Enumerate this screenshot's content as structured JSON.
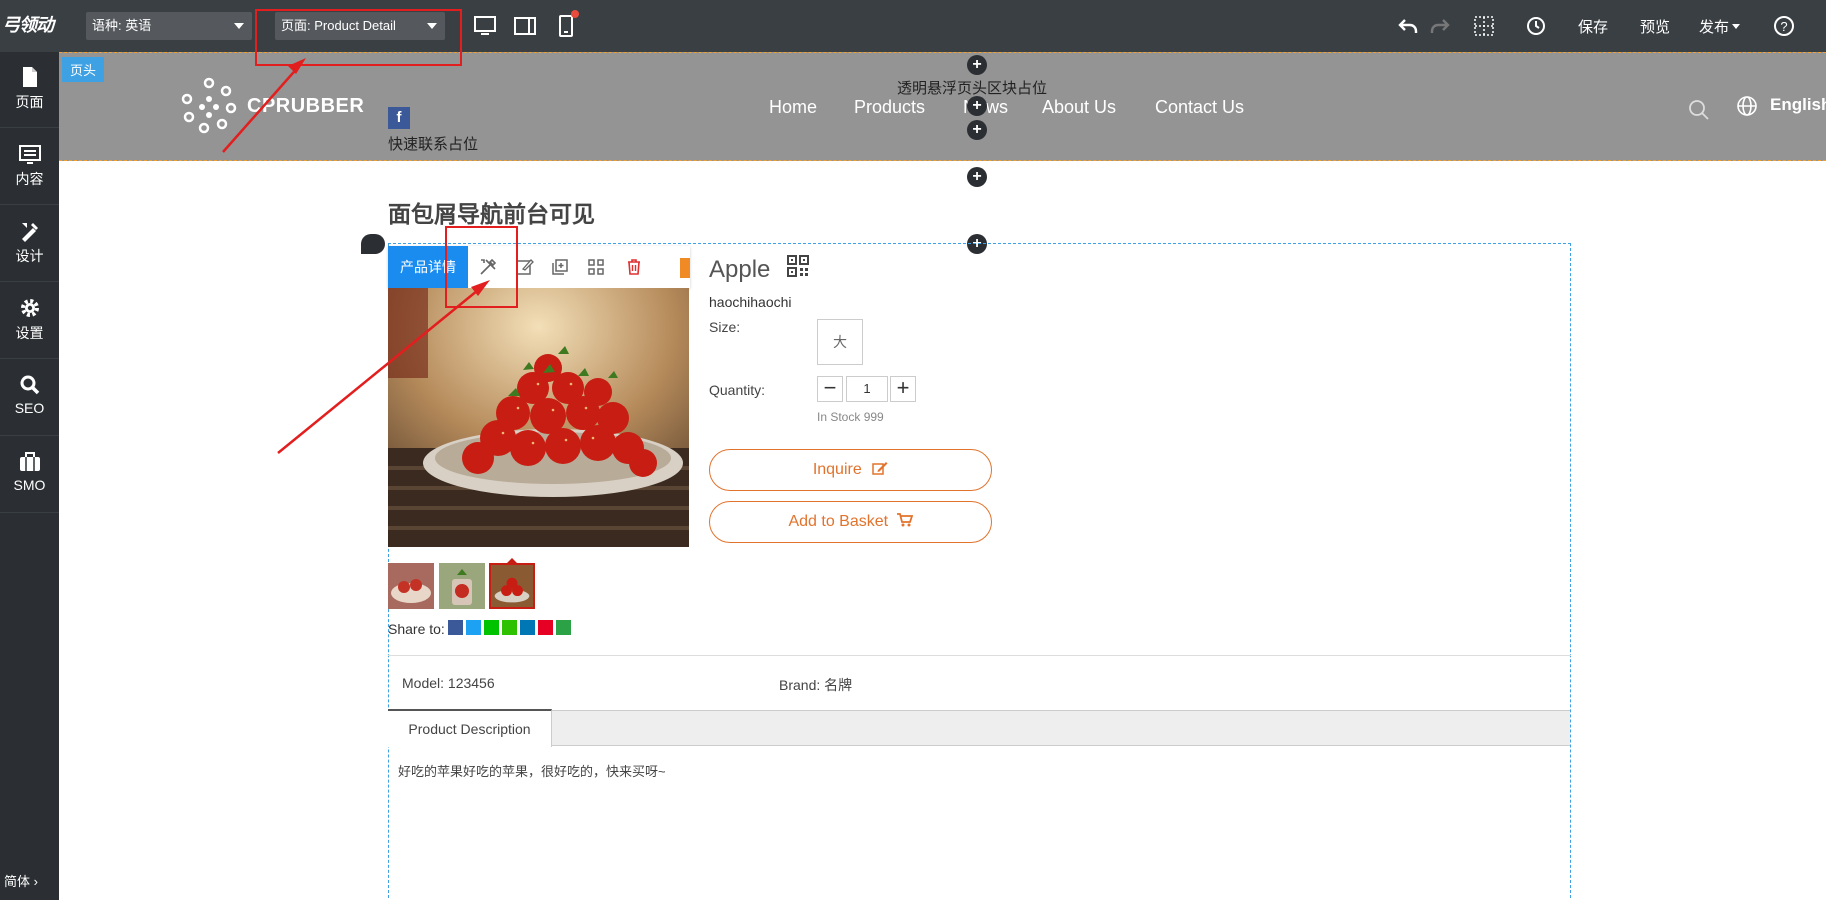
{
  "toolbar": {
    "logo": "弓领动",
    "language_select": "语种: 英语",
    "page_select": "页面:  Product Detail",
    "save": "保存",
    "preview": "预览",
    "publish": "发布"
  },
  "sidebar": {
    "items": [
      {
        "label": "页面",
        "icon": "page-icon"
      },
      {
        "label": "内容",
        "icon": "content-icon"
      },
      {
        "label": "设计",
        "icon": "design-icon"
      },
      {
        "label": "设置",
        "icon": "gear-icon"
      },
      {
        "label": "SEO",
        "icon": "search-icon"
      },
      {
        "label": "SMO",
        "icon": "briefcase-icon"
      }
    ],
    "bottom": "简体 ›"
  },
  "header": {
    "tag": "页头",
    "brand": "CPRUBBER",
    "float_label": "透明悬浮页头区块占位",
    "quick_contact": "快速联系占位",
    "facebook": "f",
    "nav": [
      "Home",
      "Products",
      "News",
      "About Us",
      "Contact Us"
    ],
    "language": "English"
  },
  "breadcrumb": "面包屑导航前台可见",
  "module": {
    "label": "产品详情"
  },
  "product": {
    "title": "Apple",
    "subtitle": "haochihaochi",
    "size_label": "Size:",
    "size_value": "大",
    "quantity_label": "Quantity:",
    "quantity": "1",
    "stock": "In Stock 999",
    "inquire": "Inquire",
    "add_to_basket": "Add to Basket",
    "share_label": "Share to:",
    "model": "Model: 123456",
    "brand": "Brand: 名牌",
    "tab": "Product Description",
    "description": "好吃的苹果好吃的苹果，很好吃的，快来买呀~"
  },
  "colors": {
    "toolbar_bg": "#3a3f44",
    "sidebar_bg": "#2b2f33",
    "header_bg": "#949494",
    "accent_blue": "#1a8cf0",
    "button_orange": "#e2732d",
    "annotation_red": "#e31e1e"
  }
}
